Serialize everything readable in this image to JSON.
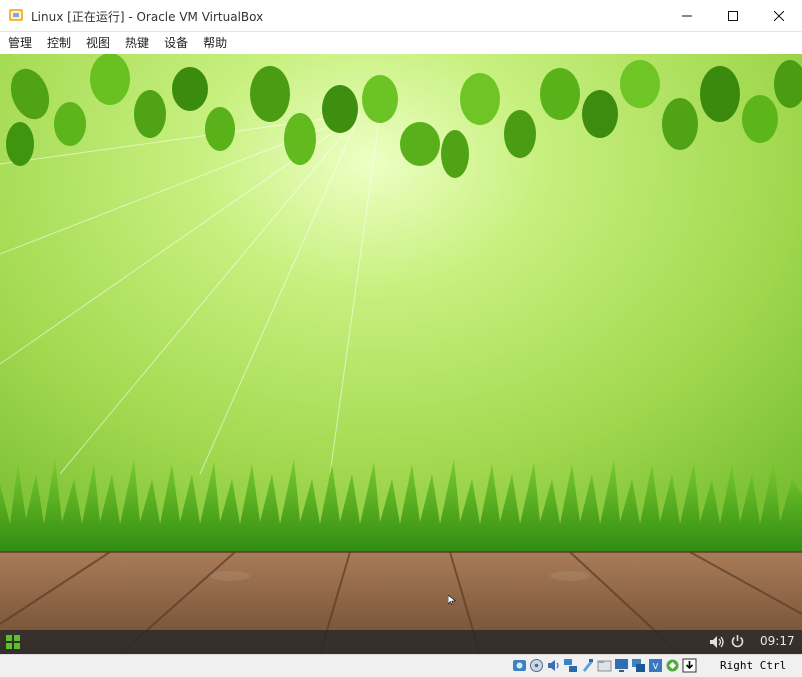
{
  "window": {
    "title": "Linux [正在运行] - Oracle VM VirtualBox"
  },
  "menu": {
    "items": [
      "管理",
      "控制",
      "视图",
      "热键",
      "设备",
      "帮助"
    ]
  },
  "guest": {
    "clock": "09:17",
    "taskbar_icons": [
      "start-menu-icon",
      "volume-icon",
      "power-icon"
    ]
  },
  "statusbar": {
    "host_key": "Right Ctrl",
    "icons": [
      "hard-disk-icon",
      "optical-drive-icon",
      "audio-icon",
      "network-icon",
      "usb-icon",
      "shared-folders-icon",
      "display-icon",
      "video-capture-icon",
      "vt-x-icon",
      "mouse-integration-icon",
      "keyboard-icon"
    ]
  },
  "colors": {
    "sky_light": "#e9ffb8",
    "sky_mid": "#a8df52",
    "sky_dark": "#5fae1e",
    "leaf": "#4b9f16",
    "grass": "#3c9a14",
    "wood": "#8a6244",
    "taskbar": "#282828"
  }
}
